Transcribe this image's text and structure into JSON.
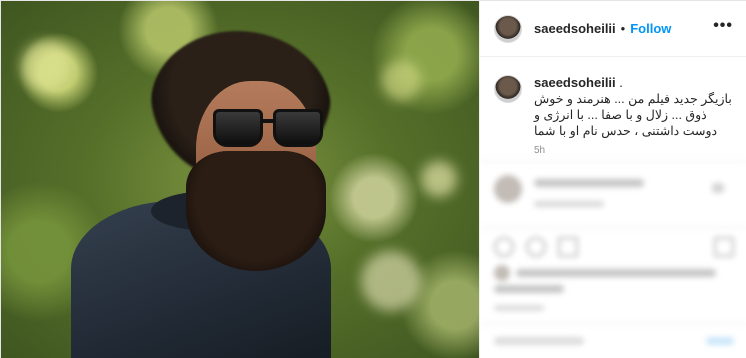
{
  "post": {
    "username": "saeedsoheilii",
    "separator_dot": "•",
    "follow_label": "Follow",
    "more_icon": "more-horizontal-icon",
    "more_glyph": "•••"
  },
  "caption": {
    "username": "saeedsoheilii",
    "username_suffix": " .",
    "text": "بازیگر جدید فیلم من ... هنرمند و خوش ذوق ... زلال و با صفا ... با انرژی و دوست داشتنی ، حدس نام او با شما",
    "time": "5h"
  }
}
